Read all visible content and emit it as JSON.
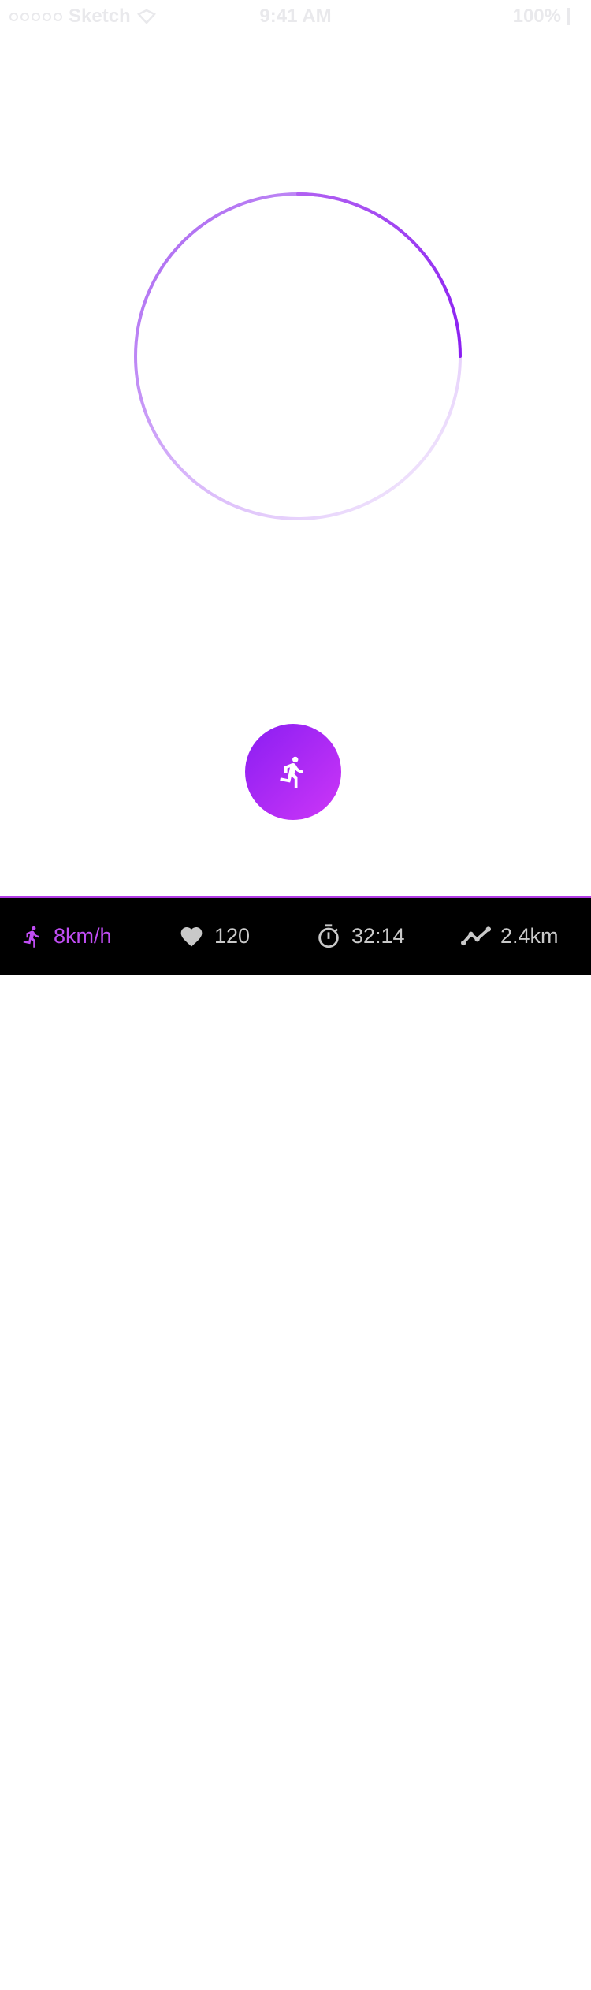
{
  "status_bar": {
    "carrier": "Sketch",
    "time": "9:41 AM",
    "battery": "100%"
  },
  "progress_ring": {
    "progress": 0.25,
    "gradient_start": "#8a1ef2",
    "gradient_end": "#f6f0fd"
  },
  "start_button": {
    "icon": "running-person-icon",
    "gradient": [
      "#8a1ef2",
      "#cd36f7"
    ]
  },
  "stats": {
    "speed": {
      "icon": "running-person-icon",
      "value": "8km/h"
    },
    "heart_rate": {
      "icon": "heart-icon",
      "value": "120"
    },
    "duration": {
      "icon": "stopwatch-icon",
      "value": "32:14"
    },
    "distance": {
      "icon": "trend-line-icon",
      "value": "2.4km"
    }
  },
  "colors": {
    "accent": "#c04df3",
    "stats_bar_bg": "#000000",
    "stats_text": "#c9c9c9"
  }
}
